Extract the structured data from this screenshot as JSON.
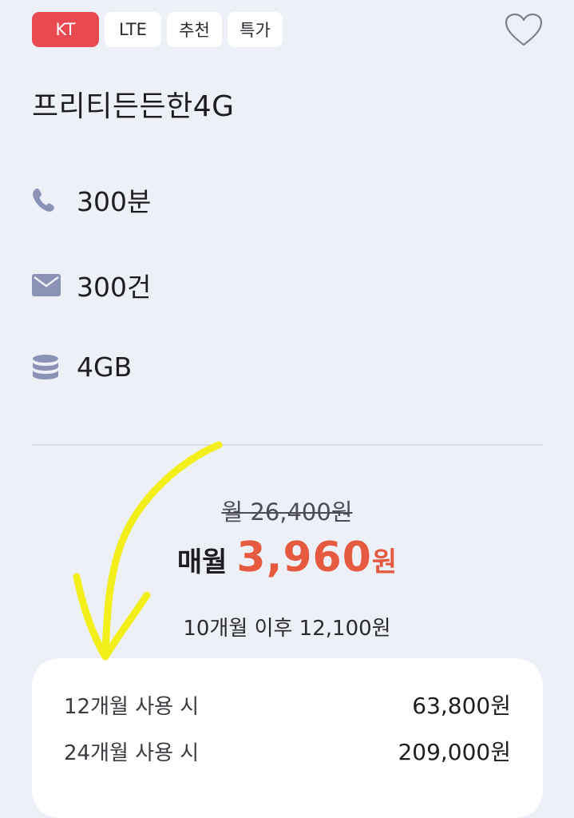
{
  "tags": {
    "carrier": "KT",
    "network": "LTE",
    "recommended": "추천",
    "special": "특가"
  },
  "plan": {
    "name": "프리티든든한4G"
  },
  "specs": {
    "voice": "300분",
    "sms": "300건",
    "data": "4GB"
  },
  "price": {
    "original": "월 26,400원",
    "monthly_label": "매월",
    "monthly_amount": "3,960",
    "monthly_unit": "원",
    "after": "10개월 이후 12,100원"
  },
  "summary": {
    "rows": [
      {
        "label": "12개월 사용 시",
        "value": "63,800원"
      },
      {
        "label": "24개월 사용 시",
        "value": "209,000원"
      }
    ]
  },
  "icons": {
    "favorite": "heart-icon",
    "voice": "phone-icon",
    "sms": "mail-icon",
    "data": "database-icon"
  },
  "colors": {
    "carrier_tag": "#e84a52",
    "price_accent": "#e65a40",
    "icon": "#8a92b6",
    "annotation": "#f2ef1a"
  }
}
